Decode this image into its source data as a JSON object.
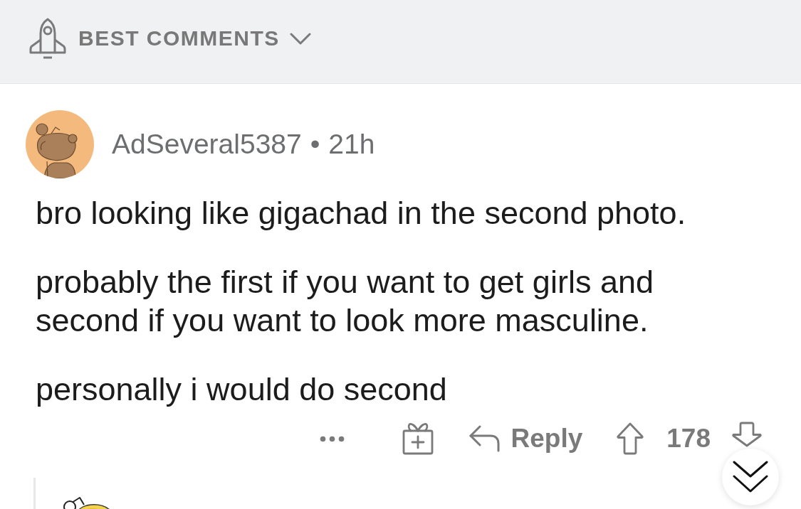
{
  "sort_menu": {
    "label": "BEST COMMENTS"
  },
  "comment": {
    "author": "AdSeveral5387",
    "separator": "•",
    "age": "21h",
    "paragraphs": [
      "bro looking like gigachad in the second photo.",
      "probably the first if you want to get girls and second if you want to look more masculine.",
      "personally i would do second"
    ],
    "reply_label": "Reply",
    "score": "178"
  }
}
